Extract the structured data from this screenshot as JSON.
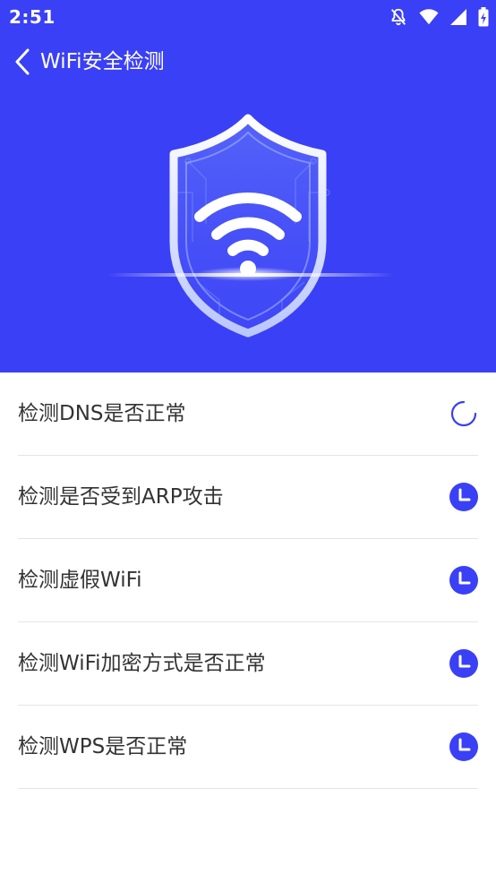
{
  "status_bar": {
    "time": "2:51",
    "icons": [
      "notifications-off-icon",
      "wifi-icon",
      "signal-icon",
      "battery-charging-icon"
    ]
  },
  "header": {
    "back_icon": "chevron-left-icon",
    "title": "WiFi安全检测"
  },
  "hero": {
    "icon": "wifi-shield-icon"
  },
  "checks": [
    {
      "label": "检测DNS是否正常",
      "status": "loading",
      "icon": "spinner-icon"
    },
    {
      "label": "检测是否受到ARP攻击",
      "status": "pending",
      "icon": "clock-icon"
    },
    {
      "label": "检测虚假WiFi",
      "status": "pending",
      "icon": "clock-icon"
    },
    {
      "label": "检测WiFi加密方式是否正常",
      "status": "pending",
      "icon": "clock-icon"
    },
    {
      "label": "检测WPS是否正常",
      "status": "pending",
      "icon": "clock-icon"
    }
  ],
  "colors": {
    "header_bg": "#3a40f5",
    "accent": "#3a40f5",
    "text": "#333333",
    "divider": "#e4e4e4"
  }
}
